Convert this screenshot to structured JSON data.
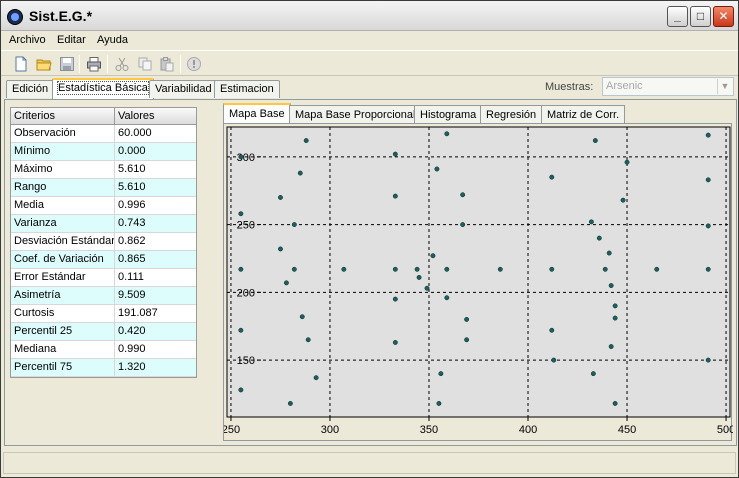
{
  "window": {
    "title": "Sist.E.G.*",
    "min": "_",
    "max": "□",
    "close": "✕"
  },
  "menu": [
    "Archivo",
    "Editar",
    "Ayuda"
  ],
  "tabs": [
    "Edición",
    "Estadística Básica",
    "Variabilidad",
    "Estimacion"
  ],
  "muestras": {
    "label": "Muestras:",
    "value": "Arsenic"
  },
  "stats_table": {
    "headers": [
      "Criterios",
      "Valores"
    ],
    "rows": [
      [
        "Observación",
        "60.000"
      ],
      [
        "Mínimo",
        "0.000"
      ],
      [
        "Máximo",
        "5.610"
      ],
      [
        "Rango",
        "5.610"
      ],
      [
        "Media",
        "0.996"
      ],
      [
        "Varianza",
        "0.743"
      ],
      [
        "Desviación Estándar",
        "0.862"
      ],
      [
        "Coef. de Variación",
        "0.865"
      ],
      [
        "Error Estándar",
        "0.111"
      ],
      [
        "Asimetría",
        "9.509"
      ],
      [
        "Curtosis",
        "191.087"
      ],
      [
        "Percentil 25",
        "0.420"
      ],
      [
        "Mediana",
        "0.990"
      ],
      [
        "Percentil 75",
        "1.320"
      ]
    ]
  },
  "subtabs": [
    "Mapa Base",
    "Mapa Base Proporcional",
    "Histograma",
    "Regresión",
    "Matriz de Corr."
  ],
  "chart_data": {
    "type": "scatter",
    "xlim": [
      248,
      502
    ],
    "ylim": [
      108,
      322
    ],
    "xticks": [
      250,
      300,
      350,
      400,
      450,
      500
    ],
    "yticks": [
      150,
      200,
      250,
      300
    ],
    "grid": true,
    "colors": {
      "point": "#1f5e5e",
      "grid": "#000000",
      "plot_bg": "#e0e0e0"
    },
    "points": [
      [
        255,
        300
      ],
      [
        255,
        258
      ],
      [
        255,
        217
      ],
      [
        255,
        172
      ],
      [
        255,
        128
      ],
      [
        275,
        270
      ],
      [
        275,
        232
      ],
      [
        278,
        207
      ],
      [
        280,
        118
      ],
      [
        282,
        250
      ],
      [
        282,
        217
      ],
      [
        285,
        288
      ],
      [
        286,
        182
      ],
      [
        288,
        312
      ],
      [
        289,
        165
      ],
      [
        293,
        137
      ],
      [
        307,
        217
      ],
      [
        333,
        302
      ],
      [
        333,
        271
      ],
      [
        333,
        217
      ],
      [
        333,
        195
      ],
      [
        333,
        163
      ],
      [
        344,
        217
      ],
      [
        345,
        211
      ],
      [
        349,
        203
      ],
      [
        352,
        227
      ],
      [
        354,
        291
      ],
      [
        355,
        118
      ],
      [
        356,
        140
      ],
      [
        359,
        317
      ],
      [
        359,
        217
      ],
      [
        359,
        196
      ],
      [
        367,
        272
      ],
      [
        367,
        250
      ],
      [
        369,
        180
      ],
      [
        369,
        165
      ],
      [
        386,
        217
      ],
      [
        412,
        285
      ],
      [
        412,
        217
      ],
      [
        412,
        172
      ],
      [
        413,
        150
      ],
      [
        432,
        252
      ],
      [
        433,
        140
      ],
      [
        434,
        312
      ],
      [
        436,
        240
      ],
      [
        439,
        217
      ],
      [
        441,
        229
      ],
      [
        442,
        205
      ],
      [
        442,
        160
      ],
      [
        444,
        190
      ],
      [
        444,
        181
      ],
      [
        444,
        118
      ],
      [
        448,
        268
      ],
      [
        450,
        296
      ],
      [
        465,
        217
      ],
      [
        491,
        316
      ],
      [
        491,
        283
      ],
      [
        491,
        249
      ],
      [
        491,
        217
      ],
      [
        491,
        150
      ]
    ]
  }
}
